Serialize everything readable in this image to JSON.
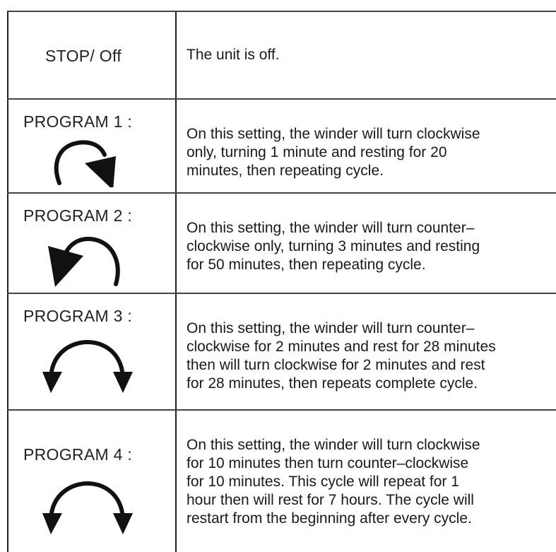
{
  "rows": [
    {
      "label": "STOP/ Off",
      "description": "The unit is off.",
      "icon": ""
    },
    {
      "label": "PROGRAM 1 :",
      "description": "On this setting, the winder will turn clockwise\nonly, turning 1 minute and resting for 20\nminutes, then repeating cycle.",
      "icon": "clockwise-arrow-icon"
    },
    {
      "label": "PROGRAM 2 :",
      "description": "On this setting, the winder will turn counter–\nclockwise only, turning 3 minutes and resting\nfor 50 minutes, then repeating cycle.",
      "icon": "counterclockwise-arrow-icon"
    },
    {
      "label": "PROGRAM 3 :",
      "description": "On this setting, the winder will turn counter–\nclockwise for 2 minutes and rest for 28 minutes\nthen will turn clockwise for 2 minutes and rest\nfor 28 minutes, then repeats complete cycle.",
      "icon": "bidirectional-arrow-icon"
    },
    {
      "label": "PROGRAM 4 :",
      "description": "On this setting, the winder will turn clockwise\nfor 10 minutes then turn counter–clockwise\nfor 10 minutes. This cycle will repeat for 1\nhour then will rest for 7 hours. The cycle will\nrestart from the beginning after every cycle.",
      "icon": "bidirectional-arrow-icon"
    }
  ]
}
